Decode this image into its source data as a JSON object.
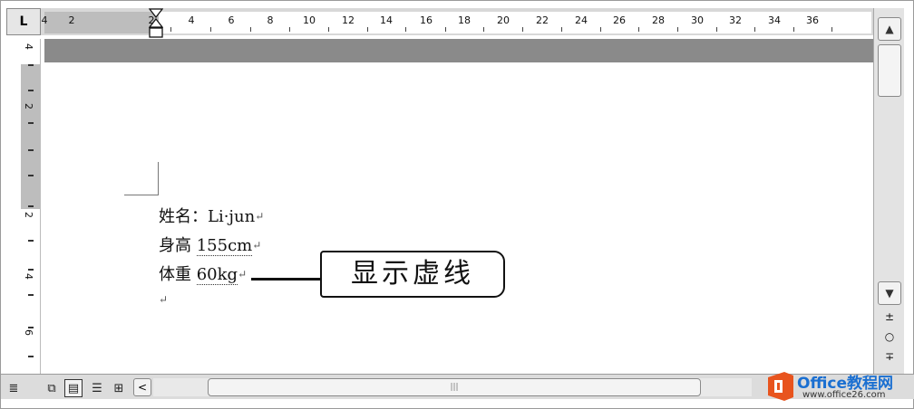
{
  "ruler": {
    "tab_selector": "L",
    "horizontal_labels": [
      "4",
      "2",
      "2",
      "4",
      "6",
      "8",
      "10",
      "12",
      "14",
      "16",
      "18",
      "20",
      "22",
      "24",
      "26",
      "28",
      "30",
      "32",
      "34",
      "36"
    ],
    "vertical_labels": [
      "4",
      "2",
      "2",
      "4",
      "6"
    ]
  },
  "document": {
    "lines": [
      {
        "text": "姓名：Li·jun",
        "mark": "↵"
      },
      {
        "label": "身高",
        "value": "155cm",
        "mark": "↵"
      },
      {
        "label": "体重",
        "value": "60kg",
        "mark": "↵"
      },
      {
        "mark": "↵"
      }
    ]
  },
  "callout": {
    "text": "显示虚线"
  },
  "scrollbar": {
    "up_icon": "▲",
    "down_icon": "▼",
    "prev_page_icon": "±",
    "select_browse_icon": "○",
    "next_page_icon": "∓"
  },
  "bottom": {
    "view_icons": [
      "normal-view-icon",
      "web-layout-icon",
      "print-layout-icon",
      "outline-view-icon",
      "reading-layout-icon"
    ],
    "scroll_left_icon": "<"
  },
  "watermark": {
    "text": "Office教程网",
    "url": "www.office26.com"
  }
}
